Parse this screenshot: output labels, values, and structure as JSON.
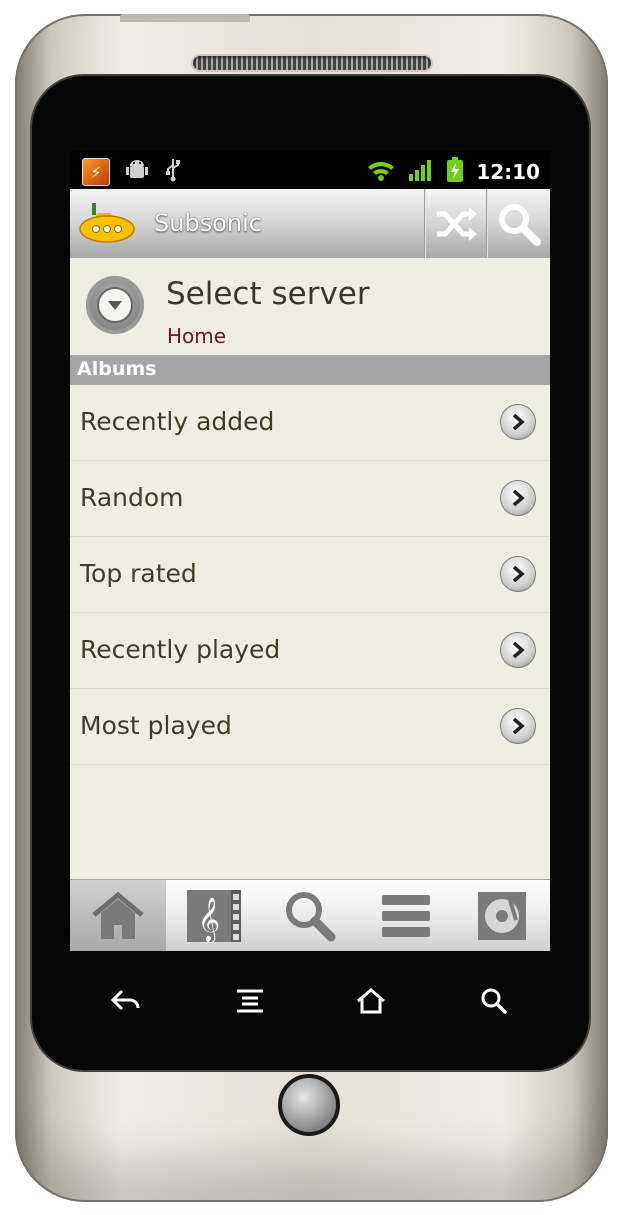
{
  "status_bar": {
    "notification_icons": [
      "subsonic-notification-icon",
      "android-debug-icon",
      "usb-icon"
    ],
    "system_icons": [
      "wifi-icon",
      "signal-icon",
      "battery-charging-icon"
    ],
    "clock": "12:10"
  },
  "action_bar": {
    "logo_icon": "submarine-logo-icon",
    "title": "Subsonic",
    "actions": [
      {
        "icon": "shuffle-icon"
      },
      {
        "icon": "search-icon"
      }
    ]
  },
  "server": {
    "icon": "dropdown-circle-icon",
    "title": "Select server",
    "subtitle": "Home"
  },
  "albums": {
    "header": "Albums",
    "items": [
      {
        "label": "Recently added"
      },
      {
        "label": "Random"
      },
      {
        "label": "Top rated"
      },
      {
        "label": "Recently played"
      },
      {
        "label": "Most played"
      }
    ]
  },
  "tab_bar": {
    "tabs": [
      {
        "icon": "home-icon",
        "active": true
      },
      {
        "icon": "library-icon",
        "active": false
      },
      {
        "icon": "search-icon",
        "active": false
      },
      {
        "icon": "playlist-icon",
        "active": false
      },
      {
        "icon": "now-playing-icon",
        "active": false
      }
    ]
  },
  "softkeys": [
    "back-icon",
    "menu-icon",
    "home-icon",
    "search-icon"
  ],
  "colors": {
    "screen_background": "#efeee4",
    "section_header": "#a6a6a6",
    "subtitle": "#7a1212",
    "list_text": "#3e3e26"
  }
}
